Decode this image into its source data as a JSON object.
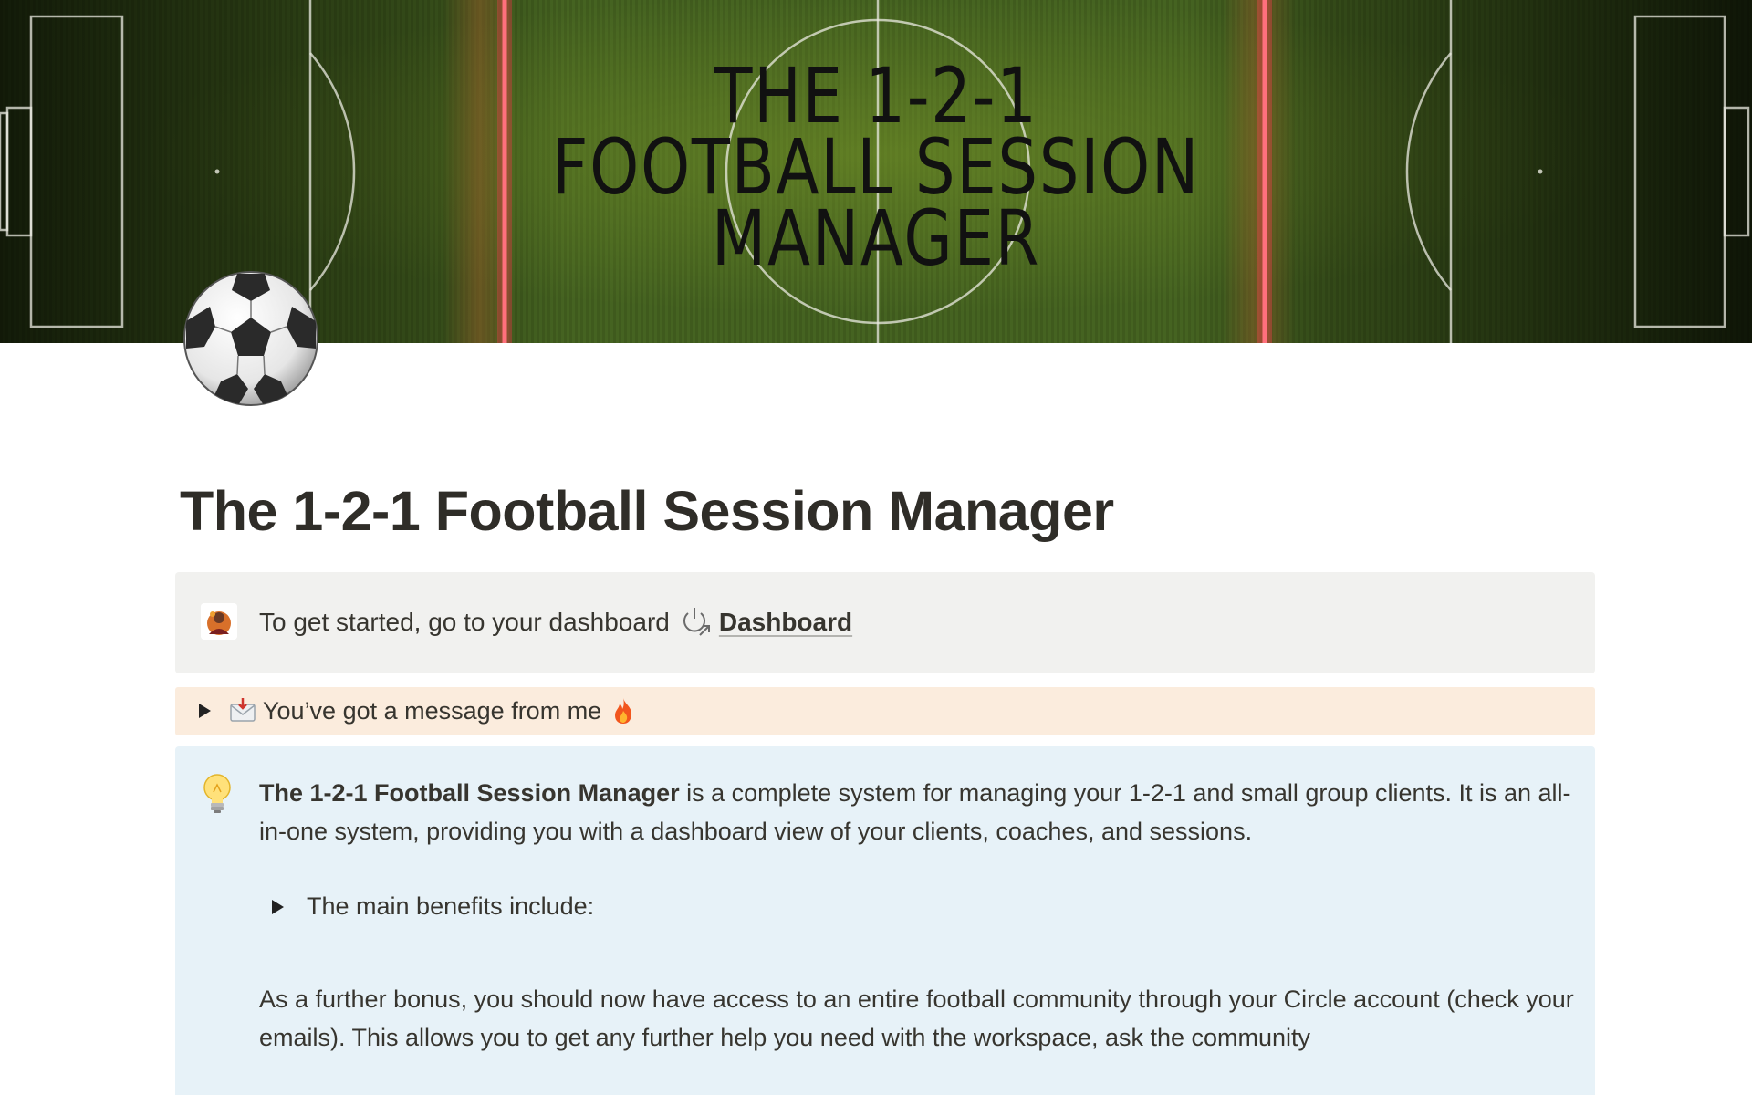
{
  "cover": {
    "line1": "THE  1-2-1",
    "line2": "FOOTBALL  SESSION",
    "line3": "MANAGER"
  },
  "page_icon": "soccer-ball-icon",
  "title": "The 1-2-1 Football Session Manager",
  "start_callout": {
    "avatar": "profile-avatar-icon",
    "text": "To get started, go to your dashboard",
    "link_icon": "linked-page-arrow-icon",
    "link_label": "Dashboard"
  },
  "message_toggle": {
    "leading_icon": "envelope-icon",
    "label": "You’ve got a message from me",
    "trailing_icon": "fire-icon"
  },
  "info_callout": {
    "icon": "light-bulb-icon",
    "intro_bold": "The 1-2-1 Football Session Manager",
    "intro_rest": " is a complete system for managing your 1-2-1 and small group clients. It is an all-in-one system, providing you with a dashboard view of your clients, coaches, and sessions.",
    "benefits_toggle": "The main benefits include:",
    "bonus_text": "As a further bonus, you should now have access to an entire football community through your Circle account (check your emails).  This allows you to get any further help you need with the workspace, ask the community"
  },
  "colors": {
    "gray_callout": "#f1f1ef",
    "orange_toggle": "#fbecdd",
    "blue_callout": "#e7f2f8",
    "text": "#37352f"
  }
}
